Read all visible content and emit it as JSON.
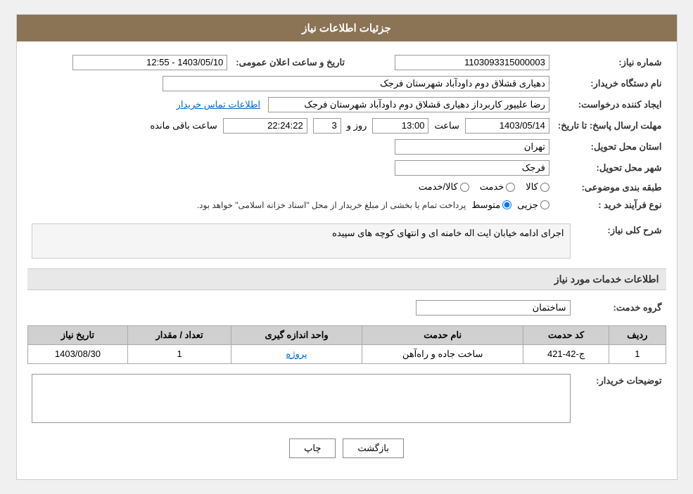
{
  "header": {
    "title": "جزئیات اطلاعات نیاز"
  },
  "fields": {
    "request_number_label": "شماره نیاز:",
    "request_number_value": "1103093315000003",
    "org_name_label": "نام دستگاه خریدار:",
    "org_name_value": "دهیاری قشلاق دوم داودآباد شهرستان فرجک",
    "announcement_date_label": "تاریخ و ساعت اعلان عمومی:",
    "announcement_date_value": "1403/05/10 - 12:55",
    "creator_label": "ایجاد کننده درخواست:",
    "creator_value": "رضا علیپور کاربرداز دهیاری قشلاق دوم داودآباد شهرستان فرجک",
    "creator_link": "اطلاعات تماس خریدار",
    "deadline_label": "مهلت ارسال پاسخ: تا تاریخ:",
    "deadline_date": "1403/05/14",
    "deadline_time_label": "ساعت",
    "deadline_time": "13:00",
    "deadline_days_label": "روز و",
    "deadline_days": "3",
    "deadline_remaining_label": "ساعت باقی مانده",
    "deadline_remaining": "22:24:22",
    "province_label": "استان محل تحویل:",
    "province_value": "تهران",
    "city_label": "شهر محل تحویل:",
    "city_value": "فرجک",
    "category_label": "طبقه بندی موضوعی:",
    "category_kala": "کالا",
    "category_khedmat": "خدمت",
    "category_kala_khedmat": "کالا/خدمت",
    "purchase_type_label": "نوع فرآیند خرید :",
    "purchase_jozii": "جزیی",
    "purchase_motavaset": "متوسط",
    "purchase_note": "پرداخت تمام یا بخشی از مبلغ خریدار از محل \"اسناد خزانه اسلامی\" خواهد بود.",
    "description_label": "شرح کلی نیاز:",
    "description_value": "اجرای ادامه خیابان ایت اله خامنه ای و انتهای کوچه های سپیده",
    "services_section_title": "اطلاعات خدمات مورد نیاز",
    "service_group_label": "گروه خدمت:",
    "service_group_value": "ساختمان",
    "table_headers": {
      "row_num": "ردیف",
      "service_code": "کد حدمت",
      "service_name": "نام حدمت",
      "unit": "واحد اندازه گیری",
      "quantity": "تعداد / مقدار",
      "date": "تاریخ نیاز"
    },
    "table_rows": [
      {
        "row_num": "1",
        "service_code": "ج-42-421",
        "service_name": "ساخت جاده و راه‌آهن",
        "unit": "پروژه",
        "quantity": "1",
        "date": "1403/08/30"
      }
    ],
    "buyer_notes_label": "توضیحات خریدار:",
    "buyer_notes_value": ""
  },
  "buttons": {
    "print": "چاپ",
    "back": "بازگشت"
  }
}
